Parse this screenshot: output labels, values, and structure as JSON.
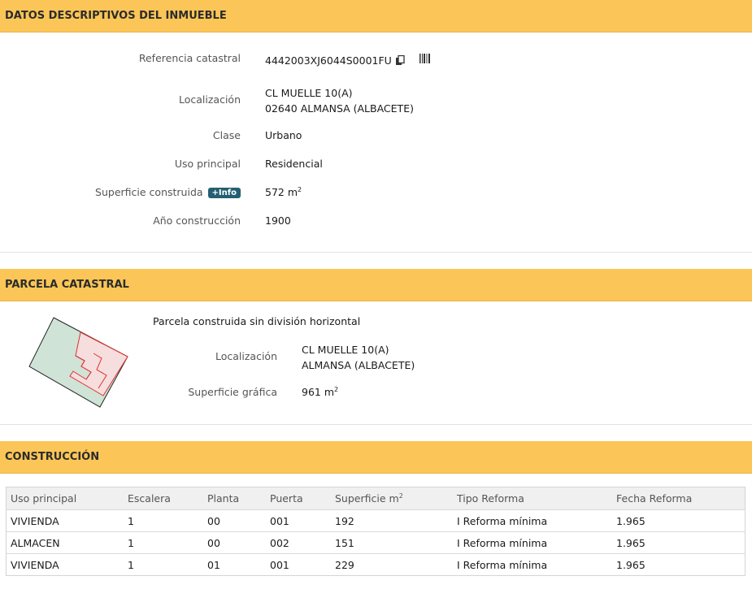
{
  "datos": {
    "header": "DATOS DESCRIPTIVOS DEL INMUEBLE",
    "ref_label": "Referencia catastral",
    "ref_value": "4442003XJ6044S0001FU",
    "loc_label": "Localización",
    "loc_line1": "CL MUELLE 10(A)",
    "loc_line2": "02640 ALMANSA (ALBACETE)",
    "clase_label": "Clase",
    "clase_value": "Urbano",
    "uso_label": "Uso principal",
    "uso_value": "Residencial",
    "sup_label": "Superficie construida",
    "sup_badge": "+Info",
    "sup_value": "572 m",
    "sup_unit_exp": "2",
    "anio_label": "Año construcción",
    "anio_value": "1900"
  },
  "parcela": {
    "header": "PARCELA CATASTRAL",
    "desc": "Parcela construida sin división horizontal",
    "loc_label": "Localización",
    "loc_line1": "CL MUELLE 10(A)",
    "loc_line2": "ALMANSA (ALBACETE)",
    "sup_label": "Superficie gráfica",
    "sup_value": "961 m",
    "sup_unit_exp": "2"
  },
  "construccion": {
    "header": "CONSTRUCCIÓN",
    "columns": [
      "Uso principal",
      "Escalera",
      "Planta",
      "Puerta",
      "Superficie m",
      "Tipo Reforma",
      "Fecha Reforma"
    ],
    "sup_col_exp": "2",
    "rows": [
      [
        "VIVIENDA",
        "1",
        "00",
        "001",
        "192",
        "I Reforma mínima",
        "1.965"
      ],
      [
        "ALMACEN",
        "1",
        "00",
        "002",
        "151",
        "I Reforma mínima",
        "1.965"
      ],
      [
        "VIVIENDA",
        "1",
        "01",
        "001",
        "229",
        "I Reforma mínima",
        "1.965"
      ]
    ]
  },
  "colors": {
    "header_bg": "#fbc657",
    "badge_bg": "#245e72",
    "parcel_fill": "#cfe3d6",
    "building_fill": "#f7dede",
    "building_stroke": "#e03030"
  }
}
